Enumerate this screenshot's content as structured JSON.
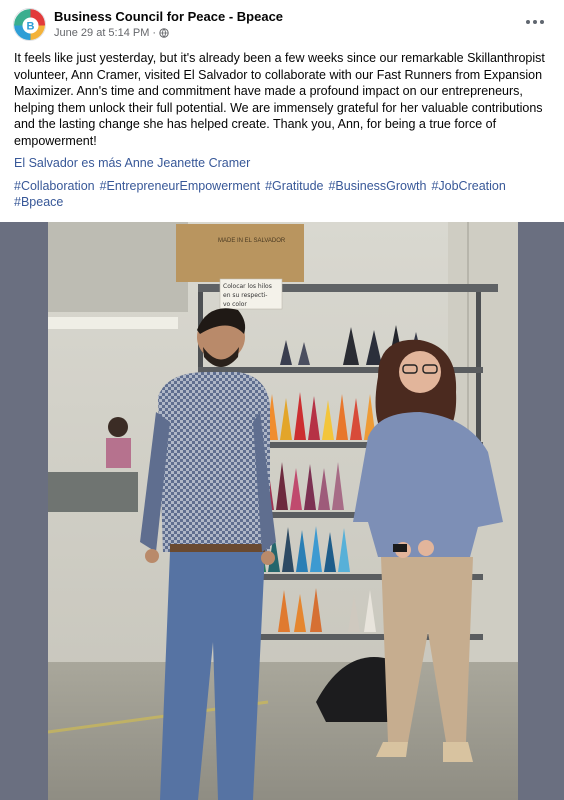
{
  "post": {
    "page_name": "Business Council for Peace - Bpeace",
    "timestamp": "June 29 at 5:14 PM",
    "separator": "·",
    "body_text": "It feels like just yesterday, but it's already been a few weeks since our remarkable Skillanthropist volunteer, Ann Cramer, visited El Salvador to collaborate with our Fast Runners from Expansion Maximizer. Ann's time and commitment have made a profound impact on our entrepreneurs, helping them unlock their full potential. We are immensely grateful for her valuable contributions and the lasting change she has helped create. Thank you, Ann, for being a true force of empowerment!",
    "mentions_prefix": "El Salvador es más",
    "mention_name": "Anne Jeanette Cramer",
    "hashtags": [
      "#Collaboration",
      "#EntrepreneurEmpowerment",
      "#Gratitude",
      "#BusinessGrowth",
      "#JobCreation",
      "#Bpeace"
    ]
  },
  "photo": {
    "box_label_1": "MADE IN EL SALVADOR",
    "sign_text_1": "Colocar los hilos",
    "sign_text_2": "en su respecti-",
    "sign_text_3": "vo color"
  },
  "colors": {
    "link": "#385898",
    "meta": "#65676b",
    "photo_letterbox": "#6a6f80"
  },
  "icons": {
    "avatar": "bpeace-logo",
    "privacy": "globe-icon",
    "menu": "more-options-icon"
  }
}
